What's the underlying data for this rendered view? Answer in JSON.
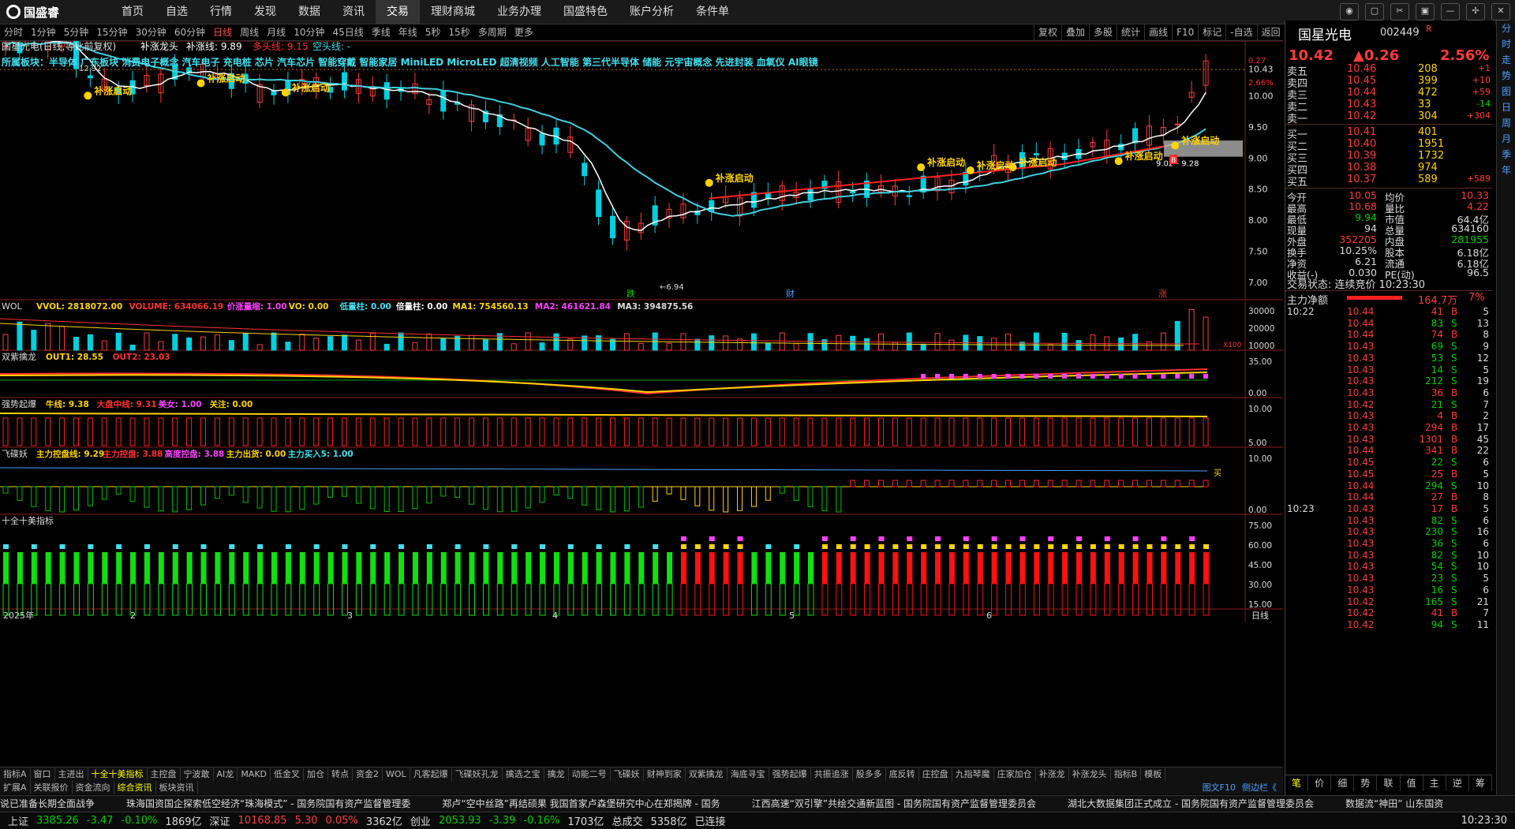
{
  "app": {
    "brand": "国盛睿"
  },
  "nav": [
    "首页",
    "自选",
    "行情",
    "发现",
    "数据",
    "资讯",
    "交易",
    "理财商城",
    "业务办理",
    "国盛特色",
    "账户分析",
    "条件单"
  ],
  "nav_active": 6,
  "periods": [
    "分时",
    "1分钟",
    "5分钟",
    "15分钟",
    "30分钟",
    "60分钟",
    "日线",
    "周线",
    "月线",
    "10分钟",
    "45日线",
    "季线",
    "年线",
    "5秒",
    "15秒",
    "多周期",
    "更多"
  ],
  "period_active": 6,
  "chart_tools": [
    "复权",
    "叠加",
    "多股",
    "统计",
    "画线",
    "F10",
    "标记",
    "-自选",
    "返回"
  ],
  "main_chart": {
    "header_name": "国星光电(日线,等比前复权)",
    "header_ind": "补涨龙头",
    "header_val": "补涨线: 9.89",
    "header_long": "多头线: 9.15",
    "header_short": "空头线: -",
    "concept_line": "所属板块：半导体 广东板块 消费电子概念 汽车电子 充电桩 芯片 汽车芯片 智能穿戴 智能家居 MiniLED MicroLED 超清视频 人工智能 第三代半导体 储能 元宇宙概念 先进封装 血氧仪 AI眼镜",
    "y_ticks": [
      "10.43",
      "10.00",
      "9.50",
      "9.00",
      "8.50",
      "8.00",
      "7.50",
      "7.00"
    ],
    "low_label": "6.94",
    "hi_label": "12.92",
    "range_label": "9.02 - 9.28",
    "signal_label": "补涨启动",
    "marker_die": "跌",
    "marker_cai": "财",
    "marker_zhang": "涨",
    "marker_b": "B",
    "percent_labels": [
      "2.66%",
      "0.27"
    ]
  },
  "panels": {
    "vol": {
      "title": "WOL",
      "items": [
        "VVOL: 2818072.00",
        "VOLUME: 634066.19",
        "价涨量缩: 1.00",
        "VO: 0.00",
        "低量柱: 0.00",
        "倍量柱: 0.00",
        "MA1: 754560.13",
        "MA2: 461621.84",
        "MA3: 394875.56"
      ],
      "ticks": [
        "30000",
        "20000",
        "10000"
      ],
      "unit": "X100"
    },
    "sz": {
      "title": "双紫擒龙",
      "items": [
        "OUT1: 28.55",
        "OUT2: 23.03"
      ],
      "ticks": [
        "35.00",
        "0.00"
      ]
    },
    "qs": {
      "title": "强势起爆",
      "items": [
        "牛线: 9.38",
        "大盘中线: 9.31",
        "美女: 1.00",
        "关注: 0.00"
      ],
      "ticks": [
        "10.00",
        "5.00"
      ]
    },
    "fdy": {
      "title": "飞碟妖",
      "items": [
        "主力控盘线: 9.29",
        "主力控盘: 3.88",
        "高度控盘: 3.88",
        "主力出货: 0.00",
        "主力买入5: 1.00"
      ],
      "ticks": [
        "10.00",
        "0.00"
      ],
      "buy": "买"
    },
    "sq": {
      "title": "十全十美指标",
      "ticks": [
        "75.00",
        "60.00",
        "45.00",
        "30.00",
        "15.00"
      ]
    }
  },
  "x_labels": [
    "2025年",
    "2",
    "3",
    "4",
    "5",
    "6"
  ],
  "period_label": "日线",
  "indicator_tabs": [
    "指标A",
    "窗口",
    "主进出",
    "十全十美指标",
    "主控盘",
    "宁波敢",
    "AI龙",
    "MAKD",
    "低金叉",
    "加仓",
    "转点",
    "资金2",
    "WOL",
    "凡客起爆",
    "飞碟妖孔龙",
    "擒选之宝",
    "擒龙",
    "动能二号",
    "飞碟妖",
    "财神到家",
    "双紫擒龙",
    "海底寻宝",
    "强势起爆",
    "共振追涨",
    "股多多",
    "底反转",
    "庄控盘",
    "九指琴魔",
    "庄家加仓",
    "补涨龙",
    "补涨龙头",
    "指标B",
    "模板"
  ],
  "indicator_active": 3,
  "sub_tabs": [
    "扩展A",
    "关联报价",
    "资金流向",
    "综合资讯",
    "板块资讯"
  ],
  "sub_active": 3,
  "right_tabs_bottom": [
    "图文F10",
    "侧边栏《"
  ],
  "news": [
    "说已准备长期全面战争",
    "珠海国资国企探索低空经济“珠海模式” - 国务院国有资产监督管理委",
    "郑卢“空中丝路”再结硕果 我国首家卢森堡研究中心在郑揭牌 - 国务",
    "江西高速“双引擎”共绘交通新蓝图 - 国务院国有资产监督管理委员会",
    "湖北大数据集团正式成立 - 国务院国有资产监督管理委员会",
    "数据流“神田” 山东国资"
  ],
  "status": {
    "sh_label": "上证",
    "sh_val": "3385.26",
    "sh_chg": "-3.47",
    "sh_pct": "-0.10%",
    "sh_amt": "1869亿",
    "sz_label": "深证",
    "sz_val": "10168.85",
    "sz_chg": "5.30",
    "sz_pct": "0.05%",
    "sz_amt": "3362亿",
    "cy_label": "创业",
    "cy_val": "2053.93",
    "cy_chg": "-3.39",
    "cy_pct": "-0.16%",
    "cy_amt": "1703亿",
    "total_label": "总成交",
    "total_val": "5358亿",
    "conn": "已连接",
    "time": "10:23:30"
  },
  "quote": {
    "name": "国星光电",
    "code": "002449",
    "flag": "R",
    "price": "10.42",
    "change": "▲0.26",
    "pct": "2.56%",
    "asks": [
      {
        "l": "卖五",
        "p": "10.46",
        "v": "208",
        "d": "+1"
      },
      {
        "l": "卖四",
        "p": "10.45",
        "v": "399",
        "d": "+10"
      },
      {
        "l": "卖三",
        "p": "10.44",
        "v": "472",
        "d": "+59"
      },
      {
        "l": "卖二",
        "p": "10.43",
        "v": "33",
        "d": "-14"
      },
      {
        "l": "卖一",
        "p": "10.42",
        "v": "304",
        "d": "+304"
      }
    ],
    "bids": [
      {
        "l": "买一",
        "p": "10.41",
        "v": "401",
        "d": ""
      },
      {
        "l": "买二",
        "p": "10.40",
        "v": "1951",
        "d": ""
      },
      {
        "l": "买三",
        "p": "10.39",
        "v": "1732",
        "d": ""
      },
      {
        "l": "买四",
        "p": "10.38",
        "v": "974",
        "d": ""
      },
      {
        "l": "买五",
        "p": "10.37",
        "v": "589",
        "d": "+589"
      }
    ],
    "stats": [
      {
        "l1": "今开",
        "v1": "10.05",
        "l2": "均价",
        "v2": "10.33"
      },
      {
        "l1": "最高",
        "v1": "10.68",
        "l2": "量比",
        "v2": "4.22"
      },
      {
        "l1": "最低",
        "v1": "9.94",
        "l2": "市值",
        "v2": "64.4亿"
      },
      {
        "l1": "现量",
        "v1": "94",
        "l2": "总量",
        "v2": "634160"
      },
      {
        "l1": "外盘",
        "v1": "352205",
        "l2": "内盘",
        "v2": "281955"
      },
      {
        "l1": "换手",
        "v1": "10.25%",
        "l2": "股本",
        "v2": "6.18亿"
      },
      {
        "l1": "净资",
        "v1": "6.21",
        "l2": "流通",
        "v2": "6.18亿"
      },
      {
        "l1": "收益(-)",
        "v1": "0.030",
        "l2": "PE(动)",
        "v2": "96.5"
      }
    ],
    "trade_state": "交易状态: 连续竞价 10:23:30",
    "main_flow_label": "主力净额",
    "main_flow_val": "164.7万",
    "main_flow_pct": "7%",
    "ticks_time1": "10:22",
    "ticks_time2": "10:23",
    "ticks": [
      {
        "p": "10.44",
        "v": "41",
        "s": "B",
        "n": "5"
      },
      {
        "p": "10.44",
        "v": "83",
        "s": "S",
        "n": "13"
      },
      {
        "p": "10.44",
        "v": "74",
        "s": "B",
        "n": "8"
      },
      {
        "p": "10.43",
        "v": "69",
        "s": "S",
        "n": "9"
      },
      {
        "p": "10.43",
        "v": "53",
        "s": "S",
        "n": "12"
      },
      {
        "p": "10.43",
        "v": "14",
        "s": "S",
        "n": "5"
      },
      {
        "p": "10.43",
        "v": "212",
        "s": "S",
        "n": "19"
      },
      {
        "p": "10.43",
        "v": "36",
        "s": "B",
        "n": "6"
      },
      {
        "p": "10.42",
        "v": "21",
        "s": "S",
        "n": "7"
      },
      {
        "p": "10.43",
        "v": "4",
        "s": "B",
        "n": "2"
      },
      {
        "p": "10.43",
        "v": "294",
        "s": "B",
        "n": "17"
      },
      {
        "p": "10.43",
        "v": "1301",
        "s": "B",
        "n": "45"
      },
      {
        "p": "10.44",
        "v": "341",
        "s": "B",
        "n": "22"
      },
      {
        "p": "10.45",
        "v": "22",
        "s": "S",
        "n": "6"
      },
      {
        "p": "10.45",
        "v": "25",
        "s": "B",
        "n": "5"
      },
      {
        "p": "10.44",
        "v": "294",
        "s": "S",
        "n": "10"
      },
      {
        "p": "10.44",
        "v": "27",
        "s": "B",
        "n": "8"
      }
    ],
    "ticks2": [
      {
        "p": "10.43",
        "v": "17",
        "s": "B",
        "n": "5"
      },
      {
        "p": "10.43",
        "v": "82",
        "s": "S",
        "n": "6"
      },
      {
        "p": "10.43",
        "v": "230",
        "s": "S",
        "n": "16"
      },
      {
        "p": "10.43",
        "v": "36",
        "s": "S",
        "n": "6"
      },
      {
        "p": "10.43",
        "v": "82",
        "s": "S",
        "n": "10"
      },
      {
        "p": "10.43",
        "v": "54",
        "s": "S",
        "n": "10"
      },
      {
        "p": "10.43",
        "v": "23",
        "s": "S",
        "n": "5"
      },
      {
        "p": "10.43",
        "v": "16",
        "s": "S",
        "n": "6"
      },
      {
        "p": "10.42",
        "v": "165",
        "s": "S",
        "n": "21"
      },
      {
        "p": "10.42",
        "v": "41",
        "s": "B",
        "n": "7"
      },
      {
        "p": "10.42",
        "v": "94",
        "s": "S",
        "n": "11"
      }
    ],
    "bottom_tabs": [
      "笔",
      "价",
      "细",
      "势",
      "联",
      "值",
      "主",
      "逆",
      "筹"
    ]
  },
  "side_icons": [
    "分",
    "时",
    "走",
    "势",
    "图",
    "日",
    "周",
    "月",
    "季",
    "年"
  ],
  "colors": {
    "up": "#ff3b3b",
    "down": "#00d0e0",
    "ma5": "#ffffff",
    "ma20": "#40d0e0",
    "ma_red": "#ff2020",
    "signal": "#ffd400"
  }
}
